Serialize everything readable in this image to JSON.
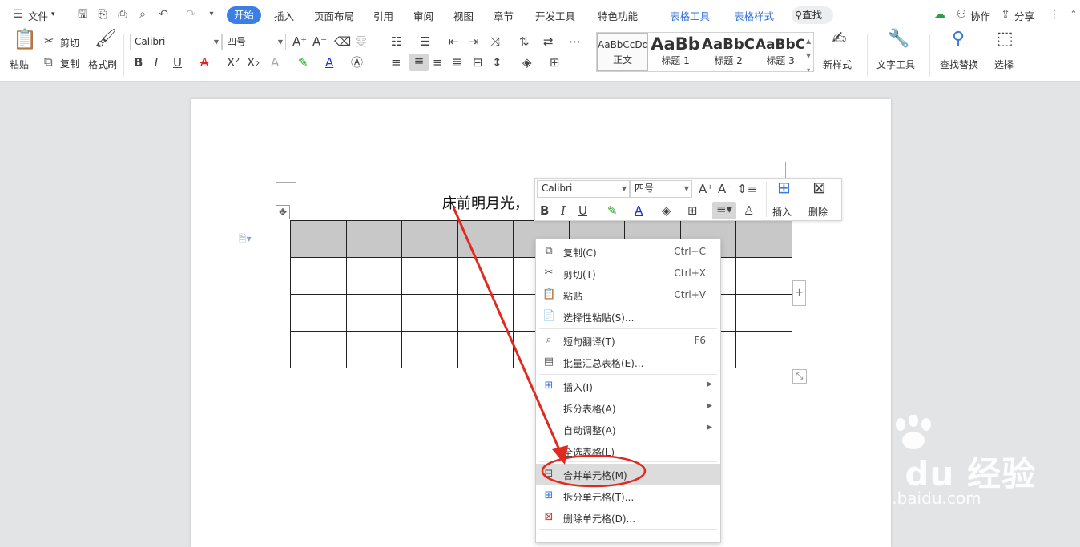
{
  "menubar": {
    "file_label": "文件",
    "tabs": [
      "开始",
      "插入",
      "页面布局",
      "引用",
      "审阅",
      "视图",
      "章节",
      "开发工具",
      "特色功能"
    ],
    "table_tabs": [
      "表格工具",
      "表格样式"
    ],
    "search_label": "查找",
    "collab_label": "协作",
    "share_label": "分享"
  },
  "ribbon": {
    "paste": "粘贴",
    "cut": "剪切",
    "copy": "复制",
    "format_painter": "格式刷",
    "font_name": "Calibri",
    "font_size": "四号",
    "styles": [
      {
        "preview": "AaBbCcDd",
        "name": "正文"
      },
      {
        "preview": "AaBb",
        "name": "标题 1"
      },
      {
        "preview": "AaBbC",
        "name": "标题 2"
      },
      {
        "preview": "AaBbC",
        "name": "标题 3"
      }
    ],
    "new_style": "新样式",
    "text_tools": "文字工具",
    "find_replace": "查找替换",
    "select": "选择"
  },
  "document": {
    "text": "床前明月光，"
  },
  "minibar": {
    "font_name": "Calibri",
    "font_size": "四号",
    "insert": "插入",
    "delete": "删除"
  },
  "context_menu": {
    "items": [
      {
        "label": "复制(C)",
        "shortcut": "Ctrl+C"
      },
      {
        "label": "剪切(T)",
        "shortcut": "Ctrl+X"
      },
      {
        "label": "粘贴",
        "shortcut": "Ctrl+V"
      },
      {
        "label": "选择性粘贴(S)...",
        "shortcut": ""
      },
      {
        "label": "短句翻译(T)",
        "shortcut": "F6"
      },
      {
        "label": "批量汇总表格(E)...",
        "shortcut": ""
      },
      {
        "label": "插入(I)",
        "shortcut": ""
      },
      {
        "label": "拆分表格(A)",
        "shortcut": ""
      },
      {
        "label": "自动调整(A)",
        "shortcut": ""
      },
      {
        "label": "全选表格(L)",
        "shortcut": ""
      },
      {
        "label": "合并单元格(M)",
        "shortcut": ""
      },
      {
        "label": "拆分单元格(T)...",
        "shortcut": ""
      },
      {
        "label": "删除单元格(D)...",
        "shortcut": ""
      }
    ]
  },
  "watermark": {
    "brand": "Bai du 经验",
    "url": "jingyan.baidu.com"
  },
  "colors": {
    "accent": "#3b7ee6",
    "annotation_red": "#e02a1f",
    "table_header": "#c8c8c8"
  }
}
